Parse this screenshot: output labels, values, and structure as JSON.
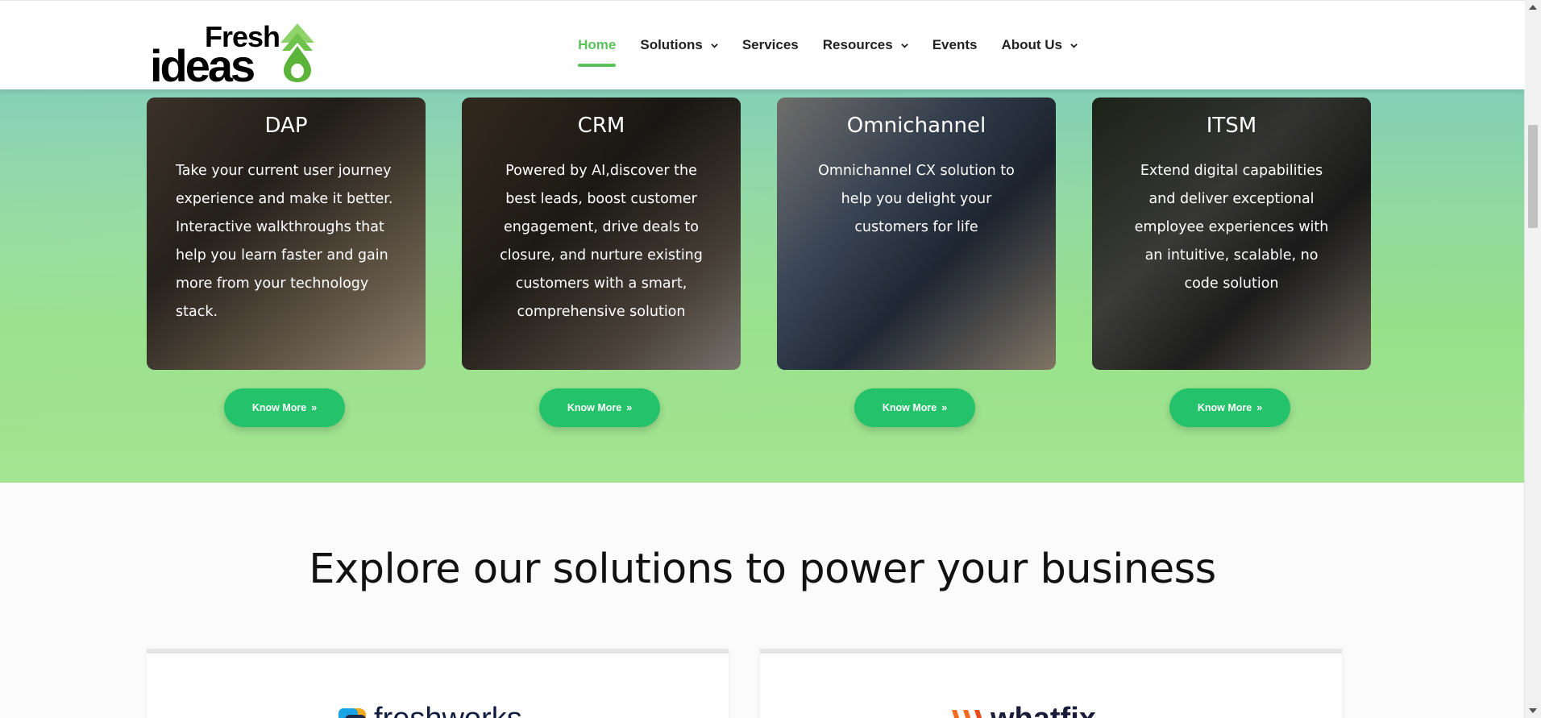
{
  "header": {
    "logo_top": "Fresh",
    "logo_bottom": "ideas",
    "nav": [
      {
        "label": "Home",
        "active": true,
        "dropdown": false
      },
      {
        "label": "Solutions",
        "active": false,
        "dropdown": true
      },
      {
        "label": "Services",
        "active": false,
        "dropdown": false
      },
      {
        "label": "Resources",
        "active": false,
        "dropdown": true
      },
      {
        "label": "Events",
        "active": false,
        "dropdown": false
      },
      {
        "label": "About Us",
        "active": false,
        "dropdown": true
      }
    ]
  },
  "cards": [
    {
      "title": "DAP",
      "text": "Take your current user journey experience and make it better. Interactive walkthroughs that help you learn faster and gain more from your technology stack.",
      "button": "Know More",
      "button_icon": "double-chevron-right-icon"
    },
    {
      "title": "CRM",
      "text": "Powered by AI,discover the best leads, boost customer engagement, drive deals to closure, and nurture existing customers with a smart, comprehensive solution",
      "button": "Know More",
      "button_icon": "double-chevron-right-icon"
    },
    {
      "title": "Omnichannel",
      "text": "Omnichannel CX solution to help you delight your customers for life",
      "button": "Know More",
      "button_icon": "double-chevron-right-icon"
    },
    {
      "title": "ITSM",
      "text": "Extend digital capabilities and deliver exceptional employee experiences with an intuitive, scalable, no code solution",
      "button": "Know More",
      "button_icon": "double-chevron-right-icon"
    }
  ],
  "explore": {
    "heading": "Explore our solutions to power your business",
    "solutions": [
      {
        "logo_text": "freshworks"
      },
      {
        "logo_text": "whatfix"
      }
    ]
  },
  "colors": {
    "accent": "#5cc25b",
    "button": "#24c26a",
    "hero_top": "#84cfb8",
    "hero_bottom": "#a4e592"
  }
}
